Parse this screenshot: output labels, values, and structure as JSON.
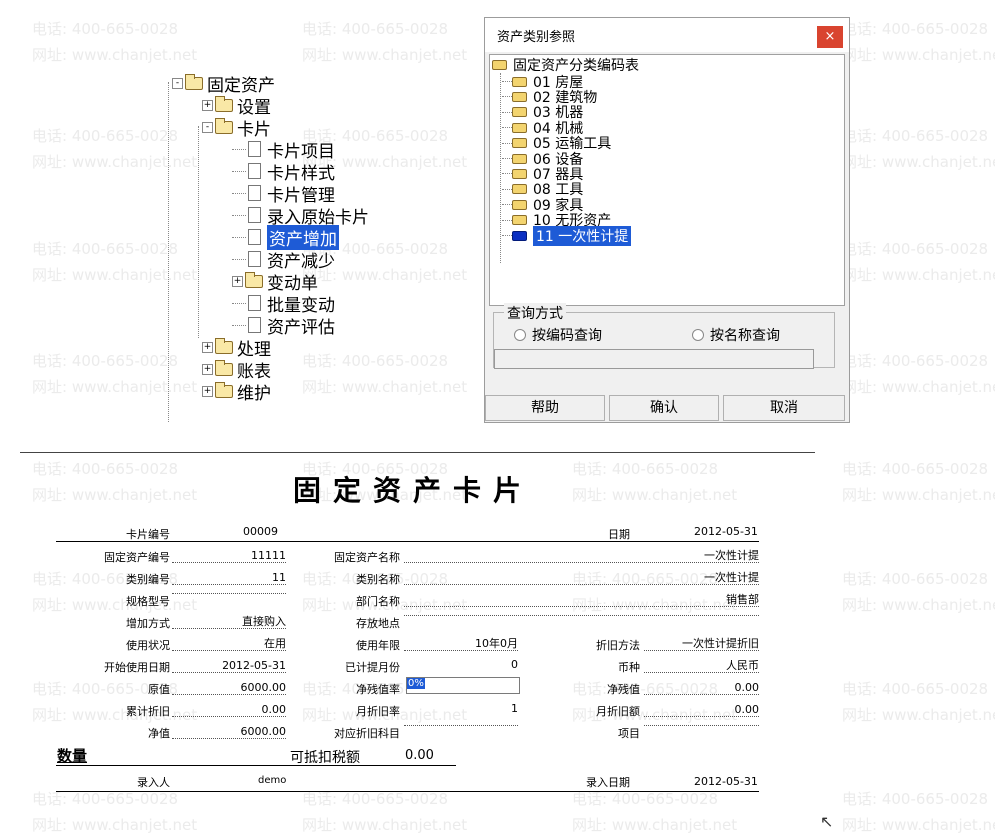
{
  "watermark": {
    "phone": "电话: 400-665-0028",
    "site": "网址: www.chanjet.net"
  },
  "tree": {
    "items": [
      {
        "label": "固定资产",
        "level": 0,
        "kind": "folder",
        "expander": "-"
      },
      {
        "label": "设置",
        "level": 1,
        "kind": "folder",
        "expander": "+"
      },
      {
        "label": "卡片",
        "level": 1,
        "kind": "folder",
        "expander": "-"
      },
      {
        "label": "卡片项目",
        "level": 2,
        "kind": "doc"
      },
      {
        "label": "卡片样式",
        "level": 2,
        "kind": "doc"
      },
      {
        "label": "卡片管理",
        "level": 2,
        "kind": "doc"
      },
      {
        "label": "录入原始卡片",
        "level": 2,
        "kind": "doc"
      },
      {
        "label": "资产增加",
        "level": 2,
        "kind": "doc",
        "selected": true
      },
      {
        "label": "资产减少",
        "level": 2,
        "kind": "doc"
      },
      {
        "label": "变动单",
        "level": 2,
        "kind": "folder",
        "expander": "+"
      },
      {
        "label": "批量变动",
        "level": 2,
        "kind": "doc"
      },
      {
        "label": "资产评估",
        "level": 2,
        "kind": "doc"
      },
      {
        "label": "处理",
        "level": 1,
        "kind": "folder",
        "expander": "+"
      },
      {
        "label": "账表",
        "level": 1,
        "kind": "folder",
        "expander": "+"
      },
      {
        "label": "维护",
        "level": 1,
        "kind": "folder",
        "expander": "+"
      }
    ]
  },
  "dialog": {
    "title": "资产类别参照",
    "close": "×",
    "root": "固定资产分类编码表",
    "categories": [
      "01 房屋",
      "02 建筑物",
      "03 机器",
      "04 机械",
      "05 运输工具",
      "06 设备",
      "07 器具",
      "08 工具",
      "09 家具",
      "10 无形资产",
      "11 一次性计提"
    ],
    "selected_index": 10,
    "query_group": "查询方式",
    "radio_code": "按编码查询",
    "radio_name": "按名称查询",
    "btn_help": "帮助",
    "btn_ok": "确认",
    "btn_cancel": "取消"
  },
  "card": {
    "title": "固定资产卡片",
    "card_no_label": "卡片编号",
    "card_no": "00009",
    "date_label": "日期",
    "date": "2012-05-31",
    "asset_code_label": "固定资产编号",
    "asset_code": "11111",
    "asset_name_label": "固定资产名称",
    "asset_name": "一次性计提",
    "cat_code_label": "类别编号",
    "cat_code": "11",
    "cat_name_label": "类别名称",
    "cat_name": "一次性计提",
    "spec_label": "规格型号",
    "spec": "",
    "dept_label": "部门名称",
    "dept": "销售部",
    "add_method_label": "增加方式",
    "add_method": "直接购入",
    "location_label": "存放地点",
    "location": "",
    "status_label": "使用状况",
    "status": "在用",
    "life_label": "使用年限",
    "life": "10年0月",
    "dep_method_label": "折旧方法",
    "dep_method": "一次性计提折旧",
    "start_label": "开始使用日期",
    "start": "2012-05-31",
    "months_label": "已计提月份",
    "months": "0",
    "currency_label": "币种",
    "currency": "人民币",
    "orig_label": "原值",
    "orig": "6000.00",
    "salvage_rate_label": "净残值率",
    "salvage_rate": "0%",
    "salvage_label": "净残值",
    "salvage": "0.00",
    "acc_dep_label": "累计折旧",
    "acc_dep": "0.00",
    "monthly_rate_label": "月折旧率",
    "monthly_rate": "1",
    "monthly_dep_label": "月折旧额",
    "monthly_dep": "0.00",
    "net_label": "净值",
    "net": "6000.00",
    "subject_label": "对应折旧科目",
    "subject": "",
    "item_label": "项目",
    "item": "",
    "qty_label": "数量",
    "tax_label": "可抵扣税额",
    "tax": "0.00",
    "entry_user_label": "录入人",
    "entry_user": "demo",
    "entry_date_label": "录入日期",
    "entry_date": "2012-05-31"
  }
}
